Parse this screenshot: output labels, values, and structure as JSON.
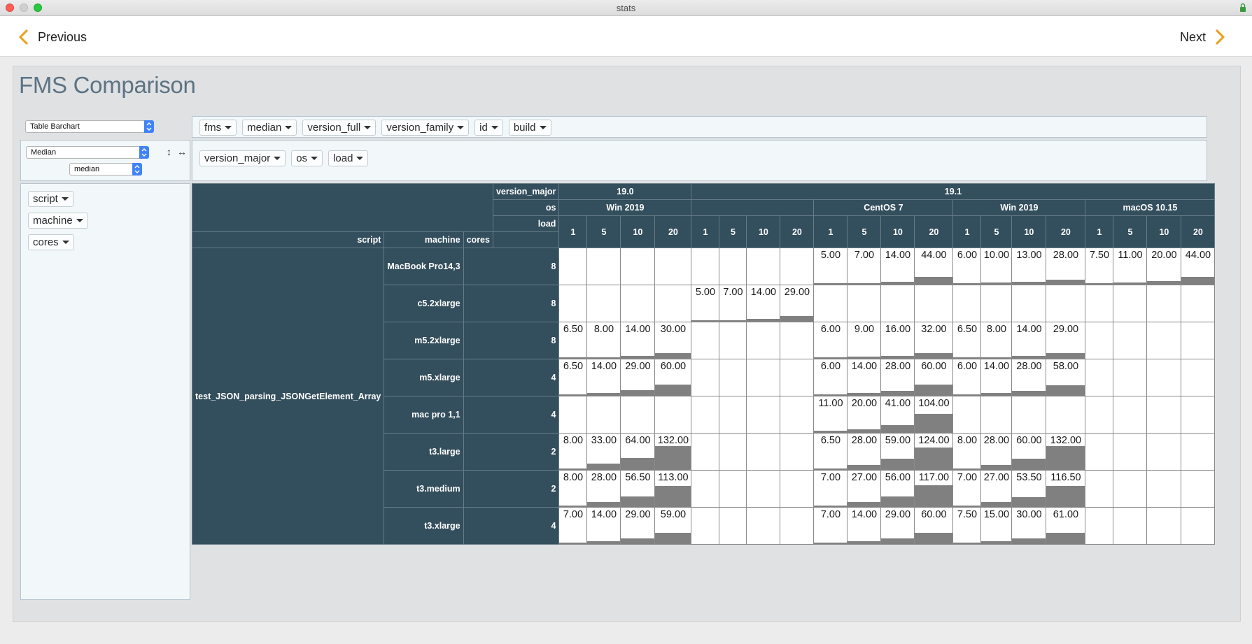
{
  "window": {
    "title": "stats"
  },
  "nav": {
    "previous_label": "Previous",
    "next_label": "Next"
  },
  "page": {
    "title": "FMS Comparison"
  },
  "controls": {
    "renderer": "Table Barchart",
    "aggregator": "Median",
    "aggregator_field": "median",
    "unused_fields": [
      "fms",
      "median",
      "version_full",
      "version_family",
      "id",
      "build"
    ],
    "col_fields": [
      "version_major",
      "os",
      "load"
    ],
    "row_fields": [
      "script",
      "machine",
      "cores"
    ]
  },
  "table": {
    "col_attr_labels": [
      "version_major",
      "os",
      "load"
    ],
    "row_attr_labels": [
      "script",
      "machine",
      "cores"
    ],
    "version_groups": [
      {
        "label": "19.0",
        "span": 4
      },
      {
        "label": "19.1",
        "span": 16
      }
    ],
    "os_groups": [
      {
        "label": "Win 2019",
        "span": 4
      },
      {
        "label": "",
        "span": 4
      },
      {
        "label": "CentOS 7",
        "span": 4
      },
      {
        "label": "Win 2019",
        "span": 4
      },
      {
        "label": "macOS 10.15",
        "span": 4
      }
    ],
    "loads": [
      "1",
      "5",
      "10",
      "20",
      "1",
      "5",
      "10",
      "20",
      "1",
      "5",
      "10",
      "20",
      "1",
      "5",
      "10",
      "20",
      "1",
      "5",
      "10",
      "20"
    ],
    "script": "test_JSON_parsing_JSONGetElement_Array",
    "rows": [
      {
        "machine": "MacBook Pro14,3",
        "cores": "8",
        "values": [
          null,
          null,
          null,
          null,
          null,
          null,
          null,
          null,
          "5.00",
          "7.00",
          "14.00",
          "44.00",
          "6.00",
          "10.00",
          "13.00",
          "28.00",
          "7.50",
          "11.00",
          "20.00",
          "44.00"
        ]
      },
      {
        "machine": "c5.2xlarge",
        "cores": "8",
        "values": [
          null,
          null,
          null,
          null,
          "5.00",
          "7.00",
          "14.00",
          "29.00",
          null,
          null,
          null,
          null,
          null,
          null,
          null,
          null,
          null,
          null,
          null,
          null
        ]
      },
      {
        "machine": "m5.2xlarge",
        "cores": "8",
        "values": [
          "6.50",
          "8.00",
          "14.00",
          "30.00",
          null,
          null,
          null,
          null,
          "6.00",
          "9.00",
          "16.00",
          "32.00",
          "6.50",
          "8.00",
          "14.00",
          "29.00",
          null,
          null,
          null,
          null
        ]
      },
      {
        "machine": "m5.xlarge",
        "cores": "4",
        "values": [
          "6.50",
          "14.00",
          "29.00",
          "60.00",
          null,
          null,
          null,
          null,
          "6.00",
          "14.00",
          "28.00",
          "60.00",
          "6.00",
          "14.00",
          "28.00",
          "58.00",
          null,
          null,
          null,
          null
        ]
      },
      {
        "machine": "mac pro 1,1",
        "cores": "4",
        "values": [
          null,
          null,
          null,
          null,
          null,
          null,
          null,
          null,
          "11.00",
          "20.00",
          "41.00",
          "104.00",
          null,
          null,
          null,
          null,
          null,
          null,
          null,
          null
        ]
      },
      {
        "machine": "t3.large",
        "cores": "2",
        "values": [
          "8.00",
          "33.00",
          "64.00",
          "132.00",
          null,
          null,
          null,
          null,
          "6.50",
          "28.00",
          "59.00",
          "124.00",
          "8.00",
          "28.00",
          "60.00",
          "132.00",
          null,
          null,
          null,
          null
        ]
      },
      {
        "machine": "t3.medium",
        "cores": "2",
        "values": [
          "8.00",
          "28.00",
          "56.50",
          "113.00",
          null,
          null,
          null,
          null,
          "7.00",
          "27.00",
          "56.00",
          "117.00",
          "7.00",
          "27.00",
          "53.50",
          "116.50",
          null,
          null,
          null,
          null
        ]
      },
      {
        "machine": "t3.xlarge",
        "cores": "4",
        "values": [
          "7.00",
          "14.00",
          "29.00",
          "59.00",
          null,
          null,
          null,
          null,
          "7.00",
          "14.00",
          "29.00",
          "60.00",
          "7.50",
          "15.00",
          "30.00",
          "61.00",
          null,
          null,
          null,
          null
        ]
      }
    ],
    "colors": {
      "header_bg": "#334e5c",
      "bar": "#808080"
    }
  }
}
